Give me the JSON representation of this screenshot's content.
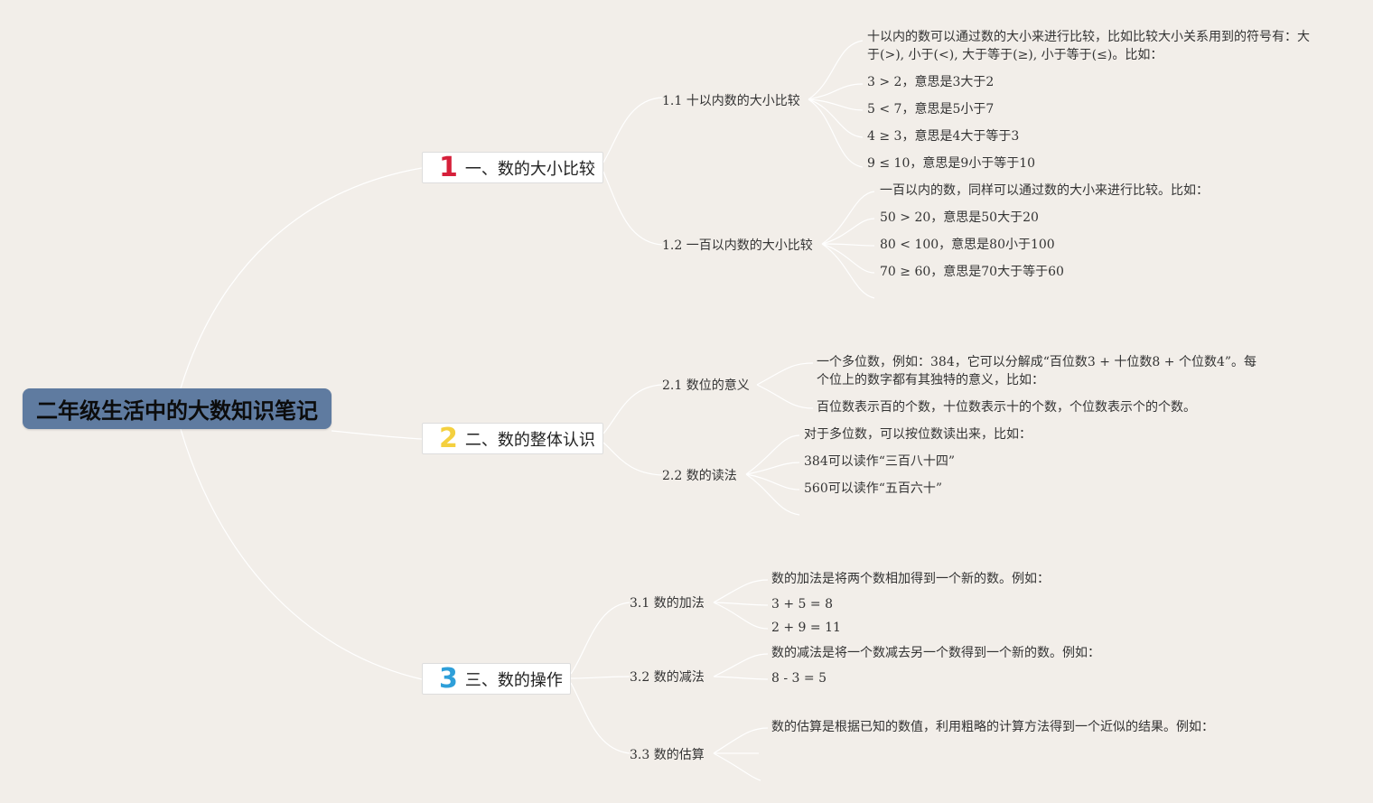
{
  "root": {
    "title": "二年级生活中的大数知识笔记"
  },
  "colors": {
    "num1": "#d6203a",
    "num2": "#f4d03f",
    "num3": "#2e9fd9",
    "root_bg": "#5f7ba0",
    "line": "#ffffff"
  },
  "topics": [
    {
      "num": "1",
      "label": "一、数的大小比较"
    },
    {
      "num": "2",
      "label": "二、数的整体认识"
    },
    {
      "num": "3",
      "label": "三、数的操作"
    }
  ],
  "subtopics": {
    "s11": "1.1 十以内数的大小比较",
    "s12": "1.2 一百以内数的大小比较",
    "s21": "2.1 数位的意义",
    "s22": "2.2 数的读法",
    "s31": "3.1 数的加法",
    "s32": "3.2 数的减法",
    "s33": "3.3 数的估算"
  },
  "leaves": {
    "s11": [
      "十以内的数可以通过数的大小来进行比较，比如比较大小关系用到的符号有：大于(>), 小于(<), 大于等于(≥), 小于等于(≤)。比如：",
      "3 > 2，意思是3大于2",
      "5 < 7，意思是5小于7",
      "4 ≥ 3，意思是4大于等于3",
      "9 ≤ 10，意思是9小于等于10"
    ],
    "s12": [
      "一百以内的数，同样可以通过数的大小来进行比较。比如：",
      "50 > 20，意思是50大于20",
      "80 < 100，意思是80小于100",
      "70 ≥ 60，意思是70大于等于60"
    ],
    "s21": [
      "一个多位数，例如：384，它可以分解成“百位数3 + 十位数8 + 个位数4”。每个位上的数字都有其独特的意义，比如：",
      "百位数表示百的个数，十位数表示十的个数，个位数表示个的个数。"
    ],
    "s22": [
      "对于多位数，可以按位数读出来，比如：",
      "384可以读作“三百八十四”",
      "560可以读作“五百六十”"
    ],
    "s31": [
      "数的加法是将两个数相加得到一个新的数。例如：",
      "3 + 5 = 8",
      "2 + 9 = 11"
    ],
    "s32": [
      "数的减法是将一个数减去另一个数得到一个新的数。例如：",
      "8 - 3 = 5"
    ],
    "s33": [
      "数的估算是根据已知的数值，利用粗略的计算方法得到一个近似的结果。例如："
    ]
  }
}
